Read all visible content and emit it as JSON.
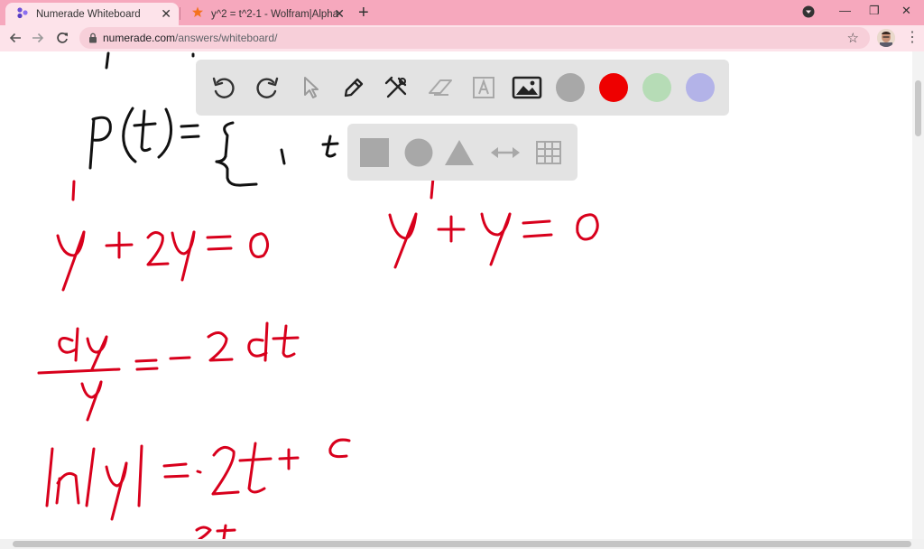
{
  "browser": {
    "tabs": [
      {
        "title": "Numerade Whiteboard",
        "active": true,
        "icon": "numerade-logo-icon"
      },
      {
        "title": "y^2 = t^2-1 - Wolfram|Alpha",
        "active": false,
        "icon": "wolfram-logo-icon"
      }
    ],
    "url_host": "numerade.com",
    "url_path": "/answers/whiteboard/",
    "colors": {
      "tabstrip": "#f6a8bd",
      "toolbar": "#fde3ea",
      "omnibox": "#f7cfd9"
    }
  },
  "whiteboard": {
    "tools": [
      {
        "name": "undo-icon"
      },
      {
        "name": "redo-icon"
      },
      {
        "name": "select-pointer-icon"
      },
      {
        "name": "pen-icon"
      },
      {
        "name": "tools-icon"
      },
      {
        "name": "eraser-icon"
      },
      {
        "name": "text-icon"
      },
      {
        "name": "image-icon"
      }
    ],
    "color_swatches": [
      "#a8a8a8",
      "#ee0000",
      "#b6dcb6",
      "#b3b3e8"
    ],
    "shapes": [
      {
        "name": "square-shape-icon"
      },
      {
        "name": "circle-shape-icon"
      },
      {
        "name": "triangle-shape-icon"
      },
      {
        "name": "double-arrow-icon"
      },
      {
        "name": "grid-icon"
      }
    ],
    "ink_colors": {
      "black": "#111111",
      "red": "#d8001c"
    }
  }
}
